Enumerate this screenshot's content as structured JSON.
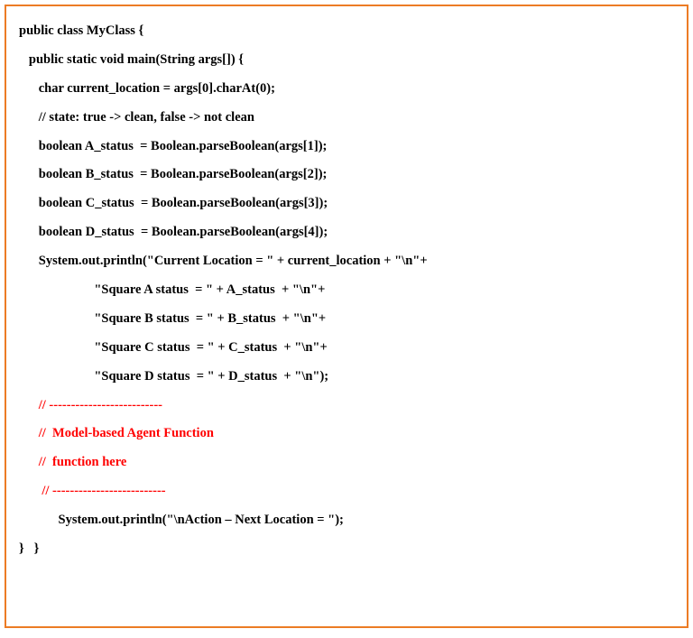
{
  "code": {
    "l1": "public class MyClass {",
    "l2": "   public static void main(String args[]) {",
    "l3": "      char current_location = args[0].charAt(0);",
    "l4": "      // state: true -> clean, false -> not clean",
    "l5": "      boolean A_status  = Boolean.parseBoolean(args[1]);",
    "l6": "      boolean B_status  = Boolean.parseBoolean(args[2]);",
    "l7": "      boolean C_status  = Boolean.parseBoolean(args[3]);",
    "l8": "      boolean D_status  = Boolean.parseBoolean(args[4]);",
    "l9": "      System.out.println(\"Current Location = \" + current_location + \"\\n\"+",
    "l10": "                       \"Square A status  = \" + A_status  + \"\\n\"+",
    "l11": "                       \"Square B status  = \" + B_status  + \"\\n\"+",
    "l12": "                       \"Square C status  = \" + C_status  + \"\\n\"+",
    "l13": "                       \"Square D status  = \" + D_status  + \"\\n\");",
    "r1": "      // --------------------------",
    "r2": "      //  Model-based Agent Function",
    "r3": "      //  function here",
    "r4": "       // --------------------------",
    "l14": "            System.out.println(\"\\nAction – Next Location = \");",
    "l15": "}   }"
  }
}
